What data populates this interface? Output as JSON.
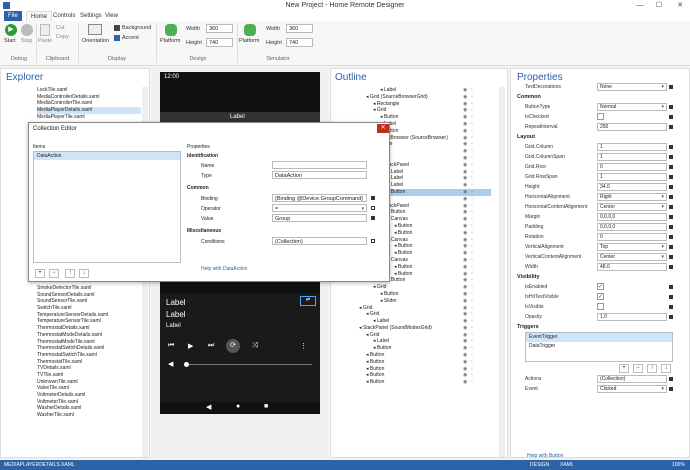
{
  "window": {
    "title": "New Project - Home Remote Designer",
    "min": "—",
    "max": "☐",
    "close": "✕"
  },
  "menu": [
    "File",
    "Home",
    "Controls",
    "Settings",
    "View"
  ],
  "ribbon": {
    "start": "Start",
    "stop": "Stop",
    "paste": "Paste",
    "cut": "Cut",
    "copy": "Copy",
    "debug": "Debug",
    "clipboard": "Clipboard",
    "orientation": "Orientation",
    "background": "Background",
    "accent": "Accent",
    "display": "Display",
    "platform": "Platform",
    "width_label": "Width",
    "height_label": "Height",
    "design": "Design",
    "simulator": "Simulator",
    "d_width": "360",
    "d_height": "740",
    "s_width": "360",
    "s_height": "740"
  },
  "explorer": {
    "title": "Explorer",
    "items_top": [
      "LockTile.xaml",
      "MediaControllerDetails.xaml",
      "MediaControllerTile.xaml",
      "MediaPlayerDetails.xaml",
      "MediaPlayerTile.xaml"
    ],
    "items_bottom": [
      "SmokeDetectorTile.xaml",
      "SoundSensorDetails.xaml",
      "SoundSensorTile.xaml",
      "SwitchTile.xaml",
      "TemperatureSensorDetails.xaml",
      "TemperatureSensorTile.xaml",
      "ThermostatDetails.xaml",
      "ThermostatModeDetails.xaml",
      "ThermostatModeTile.xaml",
      "ThermostatSwitchDetails.xaml",
      "ThermostatSwitchTile.xaml",
      "ThermostatTile.xaml",
      "TVDetails.xaml",
      "TVTile.xaml",
      "UnknownTile.xaml",
      "ValveTile.xaml",
      "VoltmeterDetails.xaml",
      "VoltmeterTile.xaml",
      "WasherDetails.xaml",
      "WasherTile.xaml"
    ]
  },
  "phone": {
    "time": "12:00",
    "label_top": "Label",
    "label1": "Label",
    "label2": "Label",
    "label3": "Label"
  },
  "dialog": {
    "title": "Collection Editor",
    "items_label": "Items",
    "selected_item": "DataAction",
    "properties_label": "Properties",
    "identification": "Identification",
    "name_label": "Name",
    "name_value": "",
    "type_label": "Type",
    "type_value": "DataAction",
    "common": "Common",
    "binding_label": "Binding",
    "binding_value": "{Binding @Device.GroupCommand}",
    "operator_label": "Operator",
    "operator_value": "=",
    "value_label": "Value",
    "value_value": "Group",
    "misc": "Miscellaneous",
    "conditions_label": "Conditions",
    "conditions_value": "(Collection)",
    "help": "Help with DataAction",
    "close": "✕"
  },
  "outline": {
    "title": "Outline",
    "rows": [
      {
        "t": "Label",
        "d": 3
      },
      {
        "t": "Grid (SourceBrowserGrid)",
        "d": 1
      },
      {
        "t": "Rectangle",
        "d": 2
      },
      {
        "t": "Grid",
        "d": 2
      },
      {
        "t": "Button",
        "d": 3
      },
      {
        "t": "Label",
        "d": 3
      },
      {
        "t": "Button",
        "d": 3
      },
      {
        "t": "MediaBrowser (SourceBrowser)",
        "d": 2
      },
      {
        "t": "Rectangle",
        "d": 1
      },
      {
        "t": "Grid",
        "d": 1
      },
      {
        "t": "Grid",
        "d": 2
      },
      {
        "t": "StackPanel",
        "d": 3
      },
      {
        "t": "Label",
        "d": 4
      },
      {
        "t": "Label",
        "d": 4
      },
      {
        "t": "Label",
        "d": 4
      },
      {
        "t": "Button",
        "d": 4,
        "sel": true
      },
      {
        "t": "Grid",
        "d": 2
      },
      {
        "t": "StackPanel",
        "d": 3
      },
      {
        "t": "Button",
        "d": 4
      },
      {
        "t": "Canvas",
        "d": 4
      },
      {
        "t": "Button",
        "d": 5
      },
      {
        "t": "Button",
        "d": 5
      },
      {
        "t": "Canvas",
        "d": 4
      },
      {
        "t": "Button",
        "d": 5
      },
      {
        "t": "Button",
        "d": 5
      },
      {
        "t": "Canvas",
        "d": 4
      },
      {
        "t": "Button",
        "d": 5
      },
      {
        "t": "Button",
        "d": 5
      },
      {
        "t": "Button",
        "d": 4
      },
      {
        "t": "Grid",
        "d": 2
      },
      {
        "t": "Button",
        "d": 3
      },
      {
        "t": "Slider",
        "d": 3
      },
      {
        "t": "Grid",
        "d": 0
      },
      {
        "t": "Grid",
        "d": 1
      },
      {
        "t": "Label",
        "d": 2
      },
      {
        "t": "StackPanel (SoundModesGrid)",
        "d": 0
      },
      {
        "t": "Grid",
        "d": 1
      },
      {
        "t": "Label",
        "d": 2
      },
      {
        "t": "Button",
        "d": 2
      },
      {
        "t": "Button",
        "d": 1
      },
      {
        "t": "Button",
        "d": 1
      },
      {
        "t": "Button",
        "d": 1
      },
      {
        "t": "Button",
        "d": 1
      },
      {
        "t": "Button",
        "d": 1
      }
    ]
  },
  "properties": {
    "title": "Properties",
    "top": {
      "label": "TextDecorations",
      "value": "None"
    },
    "common_head": "Common",
    "common": [
      {
        "l": "ButtonType",
        "v": "Normal",
        "dd": true
      },
      {
        "l": "IsChecked",
        "chk": ""
      },
      {
        "l": "RepeatInterval",
        "v": "250"
      }
    ],
    "layout_head": "Layout",
    "layout": [
      {
        "l": "Grid.Column",
        "v": "1"
      },
      {
        "l": "Grid.ColumnSpan",
        "v": "1"
      },
      {
        "l": "Grid.Row",
        "v": "0"
      },
      {
        "l": "Grid.RowSpan",
        "v": "1"
      },
      {
        "l": "Height",
        "v": "34.0"
      },
      {
        "l": "HorizontalAlignment",
        "v": "Right",
        "dd": true
      },
      {
        "l": "HorizontalContentAlignment",
        "v": "Center",
        "dd": true
      },
      {
        "l": "Margin",
        "v": "0,0,0,0"
      },
      {
        "l": "Padding",
        "v": "0,0,0,0"
      },
      {
        "l": "Rotation",
        "v": "0"
      },
      {
        "l": "VerticalAlignment",
        "v": "Top",
        "dd": true
      },
      {
        "l": "VerticalContentAlignment",
        "v": "Center",
        "dd": true
      },
      {
        "l": "Width",
        "v": "48.0"
      }
    ],
    "visibility_head": "Visibility",
    "visibility": [
      {
        "l": "IsEnabled",
        "chk": "✓"
      },
      {
        "l": "IsHitTestVisible",
        "chk": "✓"
      },
      {
        "l": "IsVisible",
        "chk": ""
      },
      {
        "l": "Opacity",
        "v": "1.0"
      }
    ],
    "triggers_head": "Triggers",
    "triggers": [
      "EventTrigger",
      "DataTrigger"
    ],
    "actions_label": "Actions",
    "actions_value": "(Collection)",
    "event_label": "Event",
    "event_value": "Clicked",
    "help": "Help with Button"
  },
  "status": {
    "file": "MEDIAPLAYERDETAILS.XAML",
    "design": "DESIGN",
    "xaml": "XAML",
    "zoom": "100%"
  },
  "colors": {
    "accent": "#2b62a8",
    "selection": "#aacdee"
  }
}
